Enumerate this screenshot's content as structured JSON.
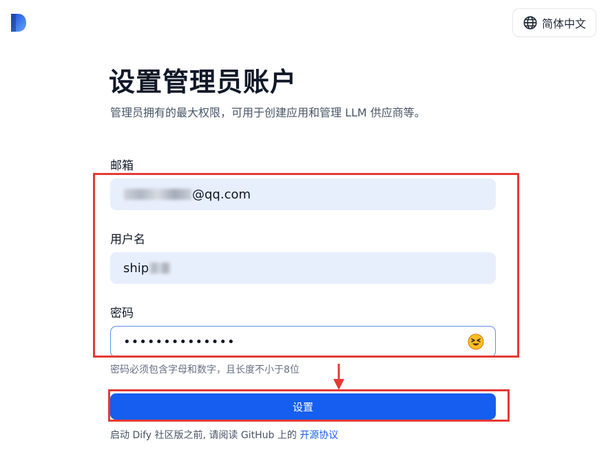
{
  "header": {
    "language_label": "简体中文"
  },
  "page": {
    "title": "设置管理员账户",
    "subtitle": "管理员拥有的最大权限，可用于创建应用和管理 LLM 供应商等。"
  },
  "form": {
    "email": {
      "label": "邮箱",
      "value_visible_suffix": "@qq.com"
    },
    "username": {
      "label": "用户名",
      "value_visible_prefix": "ship"
    },
    "password": {
      "label": "密码",
      "masked_value": "••••••••••••••"
    },
    "password_hint": "密码必须包含字母和数字，且长度不小于8位",
    "submit_label": "设置"
  },
  "footer": {
    "text": "启动 Dify 社区版之前, 请阅读 GitHub 上的",
    "link_label": "开源协议"
  },
  "colors": {
    "accent": "#155eef",
    "annotation": "#e53935",
    "input_bg": "#e8effc"
  }
}
